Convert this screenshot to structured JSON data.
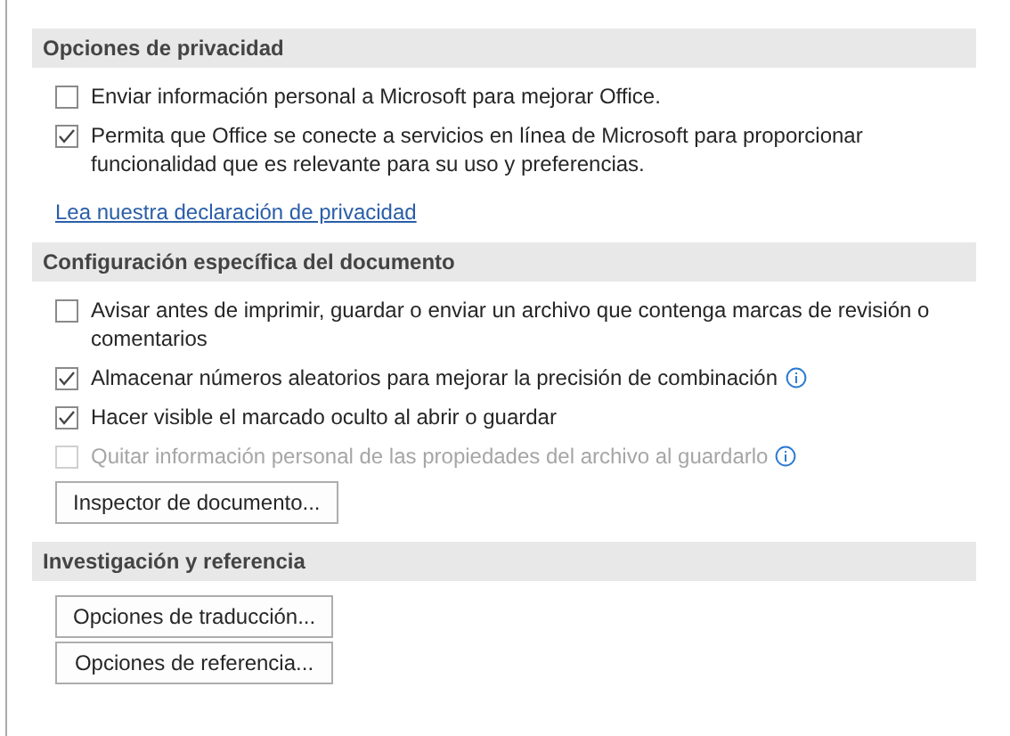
{
  "sections": [
    {
      "title": "Opciones de privacidad",
      "items": [
        {
          "kind": "checkbox",
          "label": "Enviar información personal a Microsoft para mejorar Office.",
          "checked": false,
          "disabled": false,
          "info": false
        },
        {
          "kind": "checkbox",
          "label": "Permita que Office se conecte a servicios en línea de Microsoft para proporcionar funcionalidad que es relevante para su uso y preferencias.",
          "checked": true,
          "disabled": false,
          "info": false
        },
        {
          "kind": "link",
          "label": "Lea nuestra declaración de privacidad"
        }
      ]
    },
    {
      "title": "Configuración específica del documento",
      "items": [
        {
          "kind": "checkbox",
          "label": "Avisar antes de imprimir, guardar o enviar un archivo que contenga marcas de revisión o comentarios",
          "checked": false,
          "disabled": false,
          "info": false
        },
        {
          "kind": "checkbox",
          "label": "Almacenar números aleatorios para mejorar la precisión de combinación",
          "checked": true,
          "disabled": false,
          "info": true
        },
        {
          "kind": "checkbox",
          "label": "Hacer visible el marcado oculto al abrir o guardar",
          "checked": true,
          "disabled": false,
          "info": false
        },
        {
          "kind": "checkbox",
          "label": "Quitar información personal de las propiedades del archivo al guardarlo",
          "checked": false,
          "disabled": true,
          "info": true
        },
        {
          "kind": "button",
          "label": "Inspector de documento..."
        }
      ]
    },
    {
      "title": "Investigación y referencia",
      "items": [
        {
          "kind": "button",
          "label": "Opciones de traducción..."
        },
        {
          "kind": "button",
          "label": "Opciones de referencia..."
        }
      ]
    }
  ]
}
